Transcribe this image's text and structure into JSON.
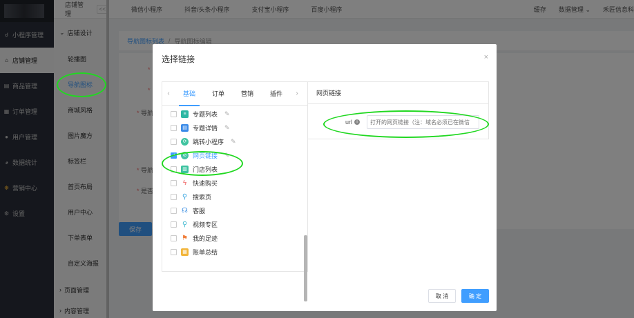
{
  "sidebar": {
    "items": [
      {
        "icon": "mini-program-icon",
        "label": "小程序管理"
      },
      {
        "icon": "store-icon",
        "label": "店铺管理"
      },
      {
        "icon": "goods-icon",
        "label": "商品管理"
      },
      {
        "icon": "order-icon",
        "label": "订单管理"
      },
      {
        "icon": "user-icon",
        "label": "用户管理"
      },
      {
        "icon": "stats-icon",
        "label": "数据统计"
      },
      {
        "icon": "marketing-icon",
        "label": "营销中心"
      },
      {
        "icon": "settings-icon",
        "label": "设置"
      }
    ]
  },
  "subnav": {
    "title": "店铺管理",
    "collapse": "<<",
    "group": "店铺设计",
    "items": [
      "轮播图",
      "导航图标",
      "商城风格",
      "图片魔方",
      "标签栏",
      "首页布局",
      "用户中心",
      "下单表单",
      "自定义海报"
    ],
    "group2": "页面管理",
    "group3": "内容管理"
  },
  "topbar": {
    "tabs": [
      "微信小程序",
      "抖音/头条小程序",
      "支付宝小程序",
      "百度小程序"
    ],
    "cache": "缓存",
    "data": "数据管理",
    "brand": "禾匠信息科"
  },
  "breadcrumb": {
    "parent": "导航图标列表",
    "sep": "/",
    "current": "导航图标编辑"
  },
  "bg_form": {
    "label1": "导航",
    "label2": "导航",
    "label3": "是否",
    "save": "保存"
  },
  "modal": {
    "title": "选择链接",
    "close": "×",
    "tabs": [
      "基础",
      "订单",
      "营销",
      "插件"
    ],
    "links": [
      {
        "label": "专题列表",
        "color": "#2db7a3",
        "checked": false
      },
      {
        "label": "专题详情",
        "color": "#3b8be8",
        "checked": false
      },
      {
        "label": "跳转小程序",
        "color": "#40c4a0",
        "checked": false
      },
      {
        "label": "网页链接",
        "color": "#46c2a6",
        "checked": true
      },
      {
        "label": "门店列表",
        "color": "#3cc3a0",
        "checked": false
      },
      {
        "label": "快速购买",
        "color": "#f06262",
        "checked": false
      },
      {
        "label": "搜索页",
        "color": "#3aa6e0",
        "checked": false
      },
      {
        "label": "客服",
        "color": "#3a8de2",
        "checked": false
      },
      {
        "label": "视频专区",
        "color": "#3fb8d0",
        "checked": false
      },
      {
        "label": "我的足迹",
        "color": "#f07f3c",
        "checked": false
      },
      {
        "label": "账单总结",
        "color": "#f2b53a",
        "checked": false
      }
    ],
    "right_title": "网页链接",
    "url_label": "url",
    "url_placeholder": "打开的网页链接（注：域名必须已在微信",
    "cancel": "取 消",
    "ok": "确 定"
  }
}
